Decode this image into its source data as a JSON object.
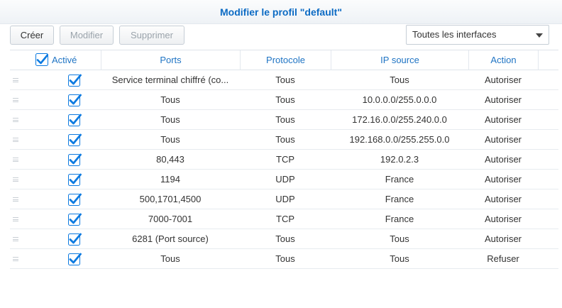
{
  "title": "Modifier le profil \"default\"",
  "toolbar": {
    "create_label": "Créer",
    "edit_label": "Modifier",
    "delete_label": "Supprimer"
  },
  "interface_select": {
    "value": "Toutes les interfaces"
  },
  "colors": {
    "accent": "#1f74c4",
    "check": "#0c7ae0"
  },
  "table": {
    "headers": {
      "enabled": "Activé",
      "ports": "Ports",
      "protocol": "Protocole",
      "ip_source": "IP source",
      "action": "Action"
    },
    "rows": [
      {
        "enabled": true,
        "ports": "Service terminal chiffré (co...",
        "protocol": "Tous",
        "ip_source": "Tous",
        "action": "Autoriser"
      },
      {
        "enabled": true,
        "ports": "Tous",
        "protocol": "Tous",
        "ip_source": "10.0.0.0/255.0.0.0",
        "action": "Autoriser"
      },
      {
        "enabled": true,
        "ports": "Tous",
        "protocol": "Tous",
        "ip_source": "172.16.0.0/255.240.0.0",
        "action": "Autoriser"
      },
      {
        "enabled": true,
        "ports": "Tous",
        "protocol": "Tous",
        "ip_source": "192.168.0.0/255.255.0.0",
        "action": "Autoriser"
      },
      {
        "enabled": true,
        "ports": "80,443",
        "protocol": "TCP",
        "ip_source": "192.0.2.3",
        "action": "Autoriser"
      },
      {
        "enabled": true,
        "ports": "1194",
        "protocol": "UDP",
        "ip_source": "France",
        "action": "Autoriser"
      },
      {
        "enabled": true,
        "ports": "500,1701,4500",
        "protocol": "UDP",
        "ip_source": "France",
        "action": "Autoriser"
      },
      {
        "enabled": true,
        "ports": "7000-7001",
        "protocol": "TCP",
        "ip_source": "France",
        "action": "Autoriser"
      },
      {
        "enabled": true,
        "ports": "6281 (Port source)",
        "protocol": "Tous",
        "ip_source": "Tous",
        "action": "Autoriser"
      },
      {
        "enabled": true,
        "ports": "Tous",
        "protocol": "Tous",
        "ip_source": "Tous",
        "action": "Refuser"
      }
    ]
  }
}
